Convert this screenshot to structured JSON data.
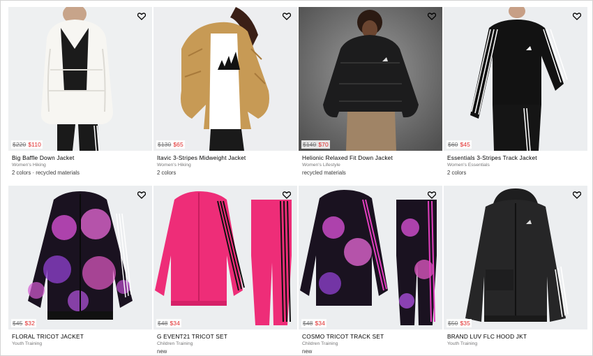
{
  "products": [
    {
      "name": "Big Baffle Down Jacket",
      "category": "Women's Hiking",
      "old_price": "$220",
      "sale_price": "$110",
      "extra": "2 colors · recycled materials",
      "image_icon": "white-puffer-jacket-photo"
    },
    {
      "name": "Itavic 3-Stripes Midweight Jacket",
      "category": "Women's Hiking",
      "old_price": "$130",
      "sale_price": "$65",
      "extra": "2 colors",
      "image_icon": "gold-puffer-jacket-photo"
    },
    {
      "name": "Helionic Relaxed Fit Down Jacket",
      "category": "Women's Lifestyle",
      "old_price": "$140",
      "sale_price": "$70",
      "extra": "recycled materials",
      "image_icon": "black-down-jacket-photo"
    },
    {
      "name": "Essentials 3-Stripes Track Jacket",
      "category": "Women's Essentials",
      "old_price": "$60",
      "sale_price": "$45",
      "extra": "2 colors",
      "image_icon": "black-track-jacket-photo"
    },
    {
      "name": "FLORAL TRICOT JACKET",
      "category": "Youth Training",
      "old_price": "$45",
      "sale_price": "$32",
      "extra": "",
      "image_icon": "floral-tricot-jacket-photo"
    },
    {
      "name": "G EVENT21 TRICOT SET",
      "category": "Children Training",
      "old_price": "$48",
      "sale_price": "$34",
      "extra": "new",
      "image_icon": "pink-tricot-set-photo"
    },
    {
      "name": "COSMO TRICOT TRACK SET",
      "category": "Children Training",
      "old_price": "$48",
      "sale_price": "$34",
      "extra": "new",
      "image_icon": "floral-track-set-photo"
    },
    {
      "name": "BRAND LUV FLC HOOD JKT",
      "category": "Youth Training",
      "old_price": "$50",
      "sale_price": "$35",
      "extra": "",
      "image_icon": "black-fleece-hood-jacket-photo"
    }
  ],
  "wishlist_icon": "heart-outline-icon",
  "colors": {
    "sale": "#e32b2b",
    "strike": "#767677",
    "image_bg": "#eceff1"
  }
}
